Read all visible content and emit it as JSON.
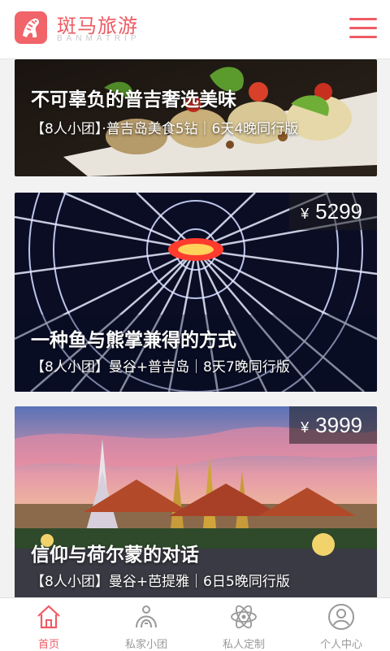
{
  "header": {
    "brand_cn": "斑马旅游",
    "brand_en": "BANMATRIP",
    "brand_color": "#ee5b63"
  },
  "cards": [
    {
      "title": "不可辜负的普吉奢选美味",
      "subtitle": "【8人小团】·普吉岛美食5钻｜6天4晚同行版",
      "price_symbol": "",
      "price": ""
    },
    {
      "title": "一种鱼与熊掌兼得的方式",
      "subtitle": "【8人小团】曼谷+普吉岛｜8天7晚同行版",
      "price_symbol": "¥",
      "price": "5299"
    },
    {
      "title": "信仰与荷尔蒙的对话",
      "subtitle": "【8人小团】曼谷+芭提雅｜6日5晚同行版",
      "price_symbol": "¥",
      "price": "3999"
    }
  ],
  "tabs": [
    {
      "label": "首页",
      "icon": "home-icon",
      "active": true
    },
    {
      "label": "私家小团",
      "icon": "group-icon",
      "active": false
    },
    {
      "label": "私人定制",
      "icon": "atom-icon",
      "active": false
    },
    {
      "label": "个人中心",
      "icon": "user-icon",
      "active": false
    }
  ]
}
